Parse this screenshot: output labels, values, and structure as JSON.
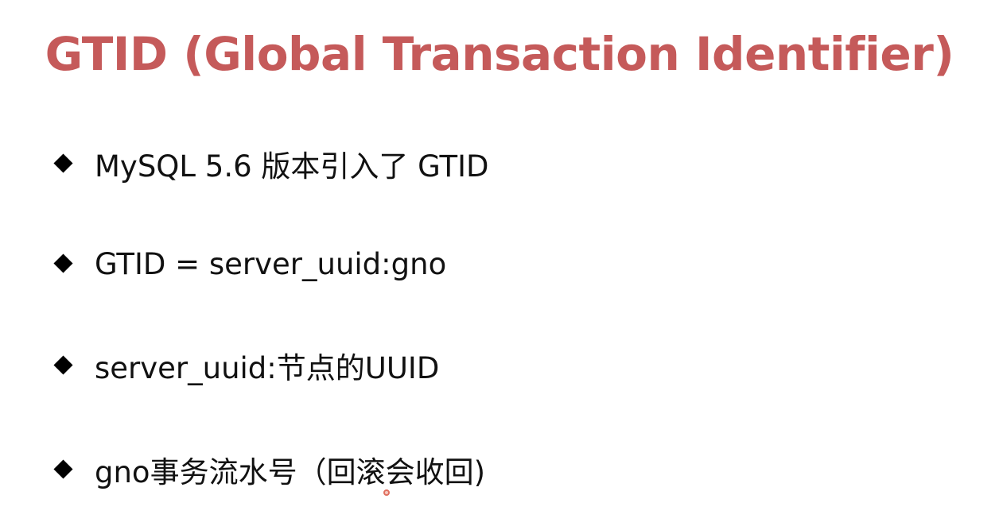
{
  "slide": {
    "title": "GTID (Global Transaction Identifier)",
    "bullets": [
      {
        "text": "MySQL 5.6 版本引入了 GTID"
      },
      {
        "text": "GTID = server_uuid:gno"
      },
      {
        "text": "server_uuid:节点的UUID"
      },
      {
        "text": "gno事务流水号（回滚会收回)"
      }
    ]
  },
  "icons": {
    "bullet": "diamond-bullet-icon",
    "pointer": "mouse-cursor-icon"
  },
  "colors": {
    "title": "#c55a5a",
    "text": "#111111",
    "bullet": "#000000",
    "background": "#ffffff"
  }
}
